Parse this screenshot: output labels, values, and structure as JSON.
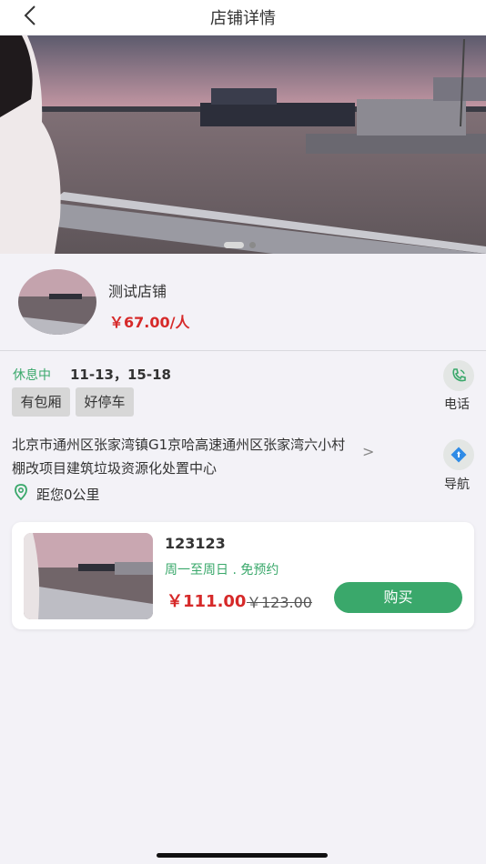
{
  "header": {
    "title": "店铺详情"
  },
  "banner": {
    "pages": 2,
    "active_page": 1
  },
  "store": {
    "name": "测试店铺",
    "price": "￥67.00/人"
  },
  "details": {
    "status": "休息中",
    "hours": "11-13，15-18",
    "tags": [
      "有包厢",
      "好停车"
    ],
    "phone_label": "电话",
    "address": "北京市通州区张家湾镇G1京哈高速通州区张家湾六小村棚改项目建筑垃圾资源化处置中心",
    "address_arrow": ">",
    "nav_label": "导航",
    "distance": "距您0公里"
  },
  "product": {
    "name": "123123",
    "subtitle": "周一至周日 . 免预约",
    "price": "￥111.00",
    "original_price": "￥123.00",
    "buy_label": "购买"
  },
  "colors": {
    "accent_green": "#3aa86b",
    "price_red": "#d62929"
  }
}
